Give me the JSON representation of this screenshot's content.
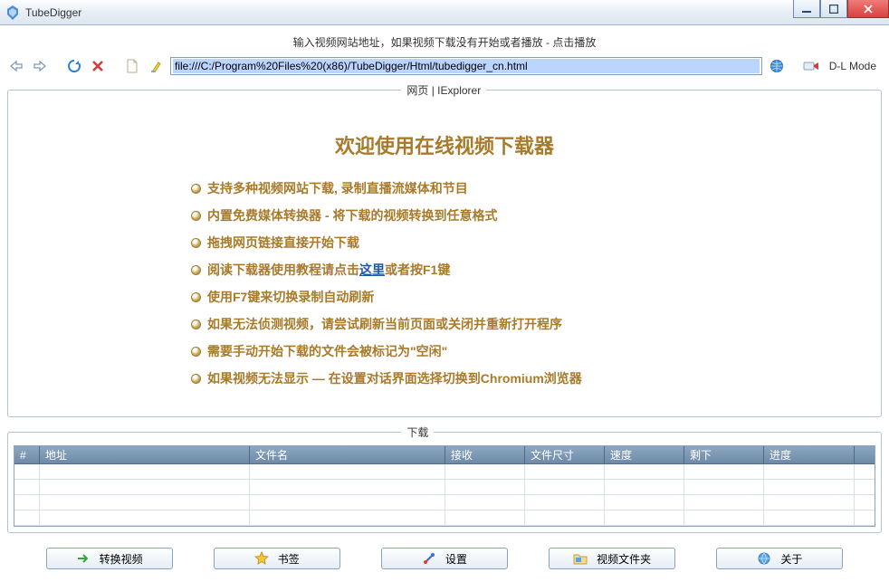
{
  "window": {
    "title": "TubeDigger"
  },
  "hint": "输入视频网站地址，如果视频下载没有开始或者播放 - 点击播放",
  "url": "file:///C:/Program%20Files%20(x86)/TubeDigger/Html/tubedigger_cn.html",
  "mode_label": "D-L Mode",
  "web_panel_title": "网页 | IExplorer",
  "welcome": "欢迎使用在线视频下载器",
  "features": [
    "支持多种视频网站下载, 录制直播流媒体和节目",
    "内置免费媒体转换器 - 将下载的视频转换到任意格式",
    "拖拽网页链接直接开始下载",
    "阅读下载器使用教程请点击",
    "使用F7键来切换录制自动刷新",
    "如果无法侦测视频，请尝试刷新当前页面或关闭并重新打开程序",
    "需要手动开始下载的文件会被标记为\"空闲\"",
    "如果视频无法显示 — 在设置对话界面选择切换到Chromium浏览器"
  ],
  "feature_link": {
    "text": "这里",
    "suffix": "或者按F1键"
  },
  "dl_panel_title": "下载",
  "columns": [
    "#",
    "地址",
    "文件名",
    "接收",
    "文件尺寸",
    "速度",
    "剩下",
    "进度",
    ""
  ],
  "buttons": {
    "convert": "转换视频",
    "bookmark": "书签",
    "settings": "设置",
    "folder": "视频文件夹",
    "about": "关于"
  }
}
